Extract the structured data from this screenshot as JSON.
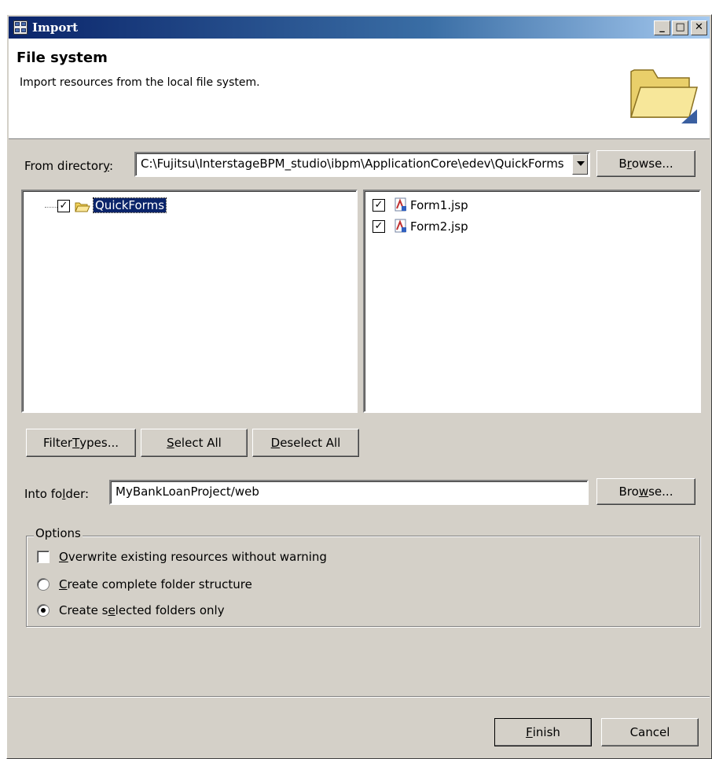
{
  "window": {
    "title": "Import",
    "buttons": {
      "minimize": "_",
      "maximize": "□",
      "close": "✕"
    }
  },
  "header": {
    "title": "File system",
    "description": "Import resources from the local file system."
  },
  "from_directory": {
    "label_pre": "From director",
    "label_mnemonic": "y",
    "label_post": ":",
    "value": "C:\\Fujitsu\\InterstageBPM_studio\\ibpm\\ApplicationCore\\edev\\QuickForms",
    "browse_pre": "B",
    "browse_mnemonic": "r",
    "browse_post": "owse..."
  },
  "tree": {
    "items": [
      {
        "label": "QuickForms",
        "checked": true,
        "selected": true
      }
    ]
  },
  "files": {
    "items": [
      {
        "label": "Form1.jsp",
        "checked": true
      },
      {
        "label": "Form2.jsp",
        "checked": true
      }
    ]
  },
  "buttons": {
    "filter_pre": "Filter ",
    "filter_mnemonic": "T",
    "filter_post": "ypes...",
    "select_mnemonic": "S",
    "select_post": "elect All",
    "deselect_mnemonic": "D",
    "deselect_post": "eselect All"
  },
  "into_folder": {
    "label_pre": "Into fo",
    "label_mnemonic": "l",
    "label_post": "der:",
    "value": "MyBankLoanProject/web",
    "browse_pre": "Bro",
    "browse_mnemonic": "w",
    "browse_post": "se..."
  },
  "options": {
    "legend": "Options",
    "overwrite": {
      "mnemonic": "O",
      "post": "verwrite existing resources without warning",
      "checked": false
    },
    "complete": {
      "mnemonic": "C",
      "post": "reate complete folder structure",
      "selected": false
    },
    "selected_only": {
      "pre": "Create s",
      "mnemonic": "e",
      "post": "lected folders only",
      "selected": true
    }
  },
  "footer": {
    "finish_mnemonic": "F",
    "finish_post": "inish",
    "cancel": "Cancel"
  }
}
